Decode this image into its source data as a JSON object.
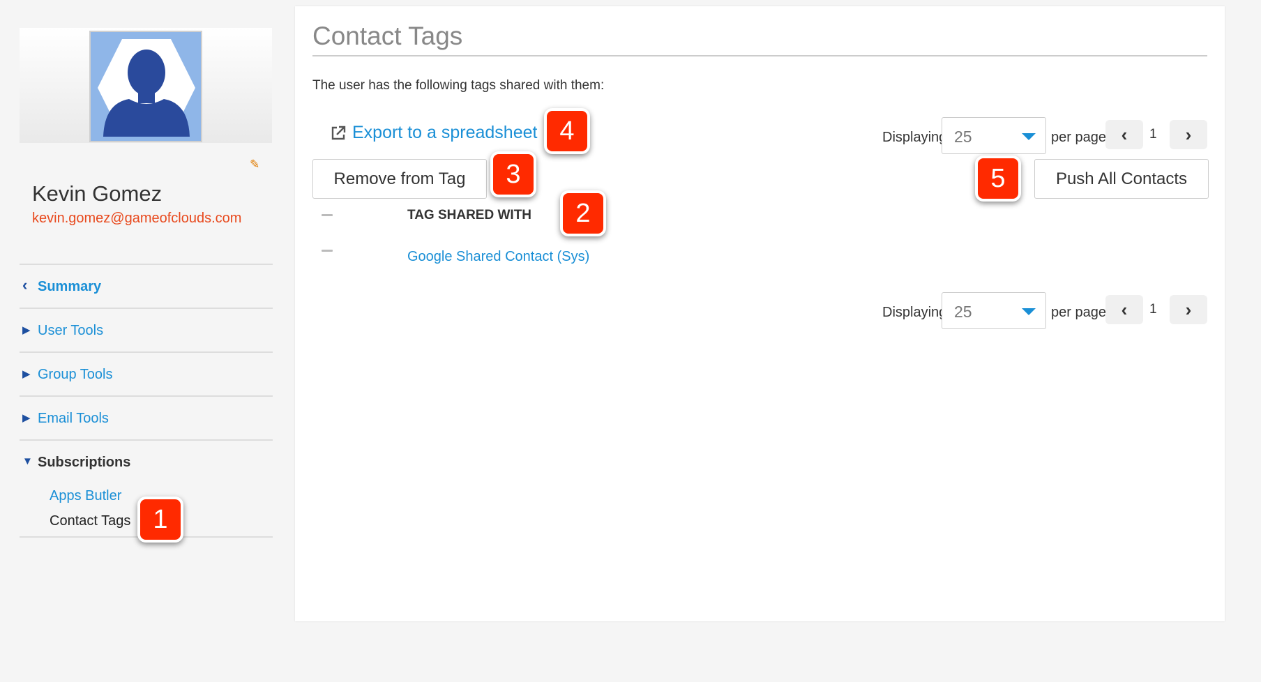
{
  "user": {
    "name": "Kevin Gomez",
    "email": "kevin.gomez@gameofclouds.com",
    "avatar_icon": "person-silhouette-icon",
    "edit_icon": "pencil-icon"
  },
  "nav": {
    "items": [
      {
        "label": "Summary",
        "icon": "chevron-left-icon"
      },
      {
        "label": "User Tools",
        "icon": "triangle-right-icon"
      },
      {
        "label": "Group Tools",
        "icon": "triangle-right-icon"
      },
      {
        "label": "Email Tools",
        "icon": "triangle-right-icon"
      },
      {
        "label": "Subscriptions",
        "icon": "triangle-down-icon"
      }
    ],
    "sub_items": [
      "Apps Butler",
      "Contact Tags"
    ]
  },
  "main": {
    "title": "Contact Tags",
    "intro": "The user has the following tags shared with them:",
    "export_label": "Export to a spreadsheet",
    "remove_label": "Remove from Tag",
    "push_label": "Push All Contacts",
    "table": {
      "header": "TAG SHARED WITH",
      "rows": [
        "Google Shared Contact (Sys)"
      ]
    },
    "pager": {
      "displaying_label": "Displaying",
      "per_page_value": "25",
      "per_page_label": "per page",
      "page_number": "1"
    }
  },
  "callouts": [
    "1",
    "2",
    "3",
    "4",
    "5"
  ],
  "colors": {
    "accent": "#1a8fd6",
    "email": "#e8491d",
    "callout": "#ff2a00"
  }
}
